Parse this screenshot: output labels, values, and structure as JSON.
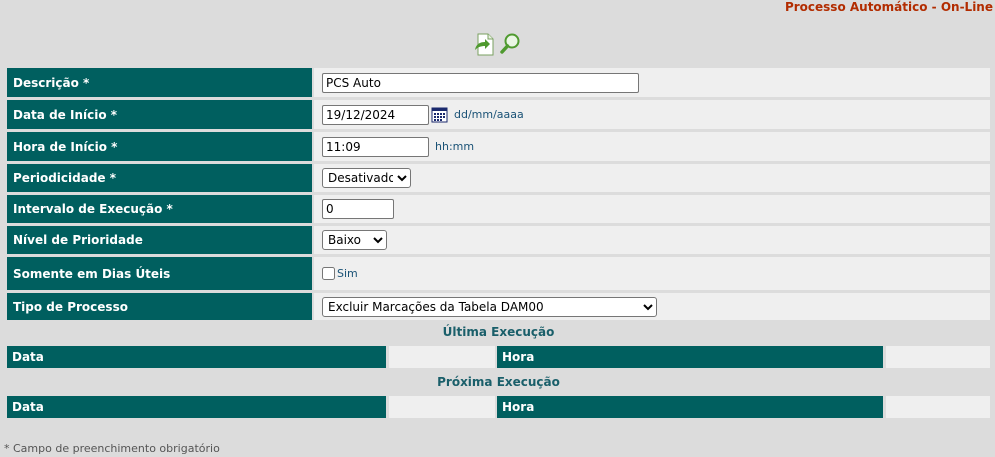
{
  "header": {
    "title": "Processo Automático - On-Line"
  },
  "toolbar": {
    "icons": [
      "execute-icon",
      "search-icon"
    ],
    "accent": "#5aaa3c"
  },
  "colors": {
    "label_bg": "#005f5f",
    "value_bg": "#efefef",
    "page_bg": "#dcdcdc",
    "title": "#b22c00"
  },
  "form": {
    "descricao": {
      "label": "Descrição *",
      "value": "PCS Auto"
    },
    "data_inicio": {
      "label": "Data de Início *",
      "value": "19/12/2024",
      "hint": "dd/mm/aaaa"
    },
    "hora_inicio": {
      "label": "Hora de Início *",
      "value": "11:09",
      "hint": "hh:mm"
    },
    "periodicidade": {
      "label": "Periodicidade *",
      "selected": "Desativado"
    },
    "intervalo": {
      "label": "Intervalo de Execução *",
      "value": "0"
    },
    "prioridade": {
      "label": "Nível de Prioridade",
      "selected": "Baixo"
    },
    "dias_uteis": {
      "label": "Somente em Dias Úteis",
      "option": "Sim",
      "checked": false
    },
    "tipo_processo": {
      "label": "Tipo de Processo",
      "selected": "Excluir Marcações da Tabela DAM00"
    }
  },
  "ultima_execucao": {
    "title": "Última Execução",
    "data_label": "Data",
    "data_value": "",
    "hora_label": "Hora",
    "hora_value": ""
  },
  "proxima_execucao": {
    "title": "Próxima Execução",
    "data_label": "Data",
    "data_value": "",
    "hora_label": "Hora",
    "hora_value": ""
  },
  "footnote": "* Campo de preenchimento obrigatório"
}
